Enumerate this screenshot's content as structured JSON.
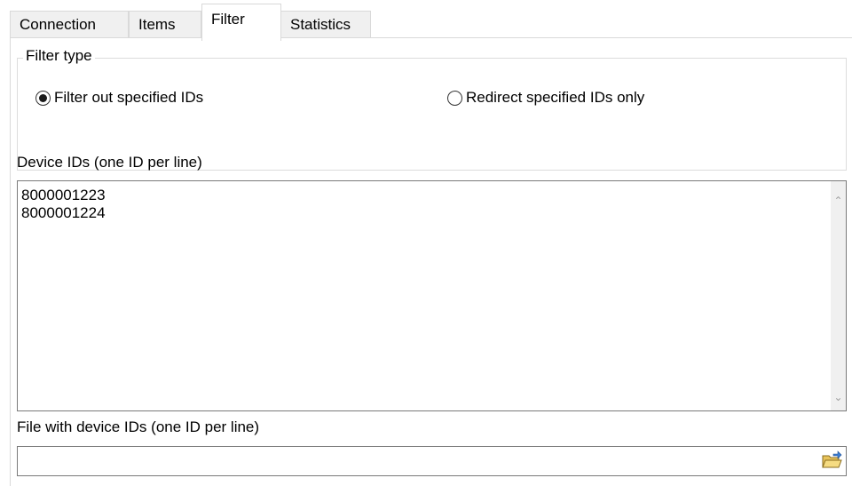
{
  "tabs": [
    {
      "label": "Connection",
      "active": false
    },
    {
      "label": "Items",
      "active": false
    },
    {
      "label": "Filter",
      "active": true
    },
    {
      "label": "Statistics",
      "active": false
    }
  ],
  "filter_type": {
    "legend": "Filter type",
    "options": [
      {
        "label": "Filter out specified IDs",
        "selected": true
      },
      {
        "label": "Redirect specified IDs only",
        "selected": false
      }
    ]
  },
  "device_ids": {
    "label": "Device IDs (one ID per line)",
    "lines": [
      "8000001223",
      "8000001224"
    ]
  },
  "file": {
    "label": "File with device IDs (one ID per line)",
    "value": "",
    "browse_icon": "folder-open-icon"
  }
}
